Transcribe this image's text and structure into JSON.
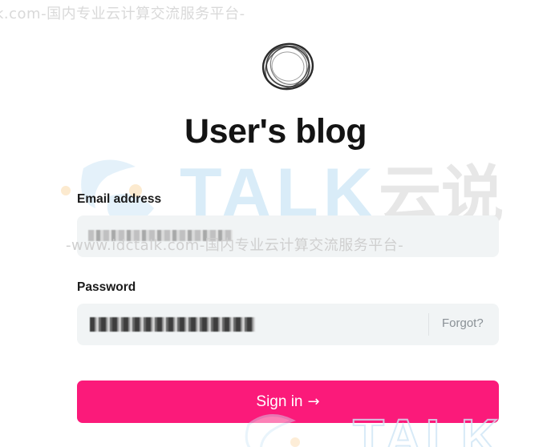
{
  "watermarks": {
    "top": "k.com-国内专业云计算交流服务平台-",
    "middle": "-www.idctalk.com-国内专业云计算交流服务平台-",
    "brand_latin": "TALK",
    "brand_cjk": "云说",
    "brand_bottom": "TALK"
  },
  "logo": {
    "icon": "scribble-circle-icon"
  },
  "title": "User's blog",
  "form": {
    "email_label": "Email address",
    "password_label": "Password",
    "forgot_label": "Forgot?",
    "signin_label": "Sign in",
    "signin_arrow": "→"
  },
  "colors": {
    "accent": "#fb1a7a",
    "field_bg": "#f1f4f5",
    "title": "#141414",
    "watermark_blue": "#cfe6f6",
    "watermark_orange": "#fbe3c4",
    "watermark_gray": "#e4e4e4"
  }
}
